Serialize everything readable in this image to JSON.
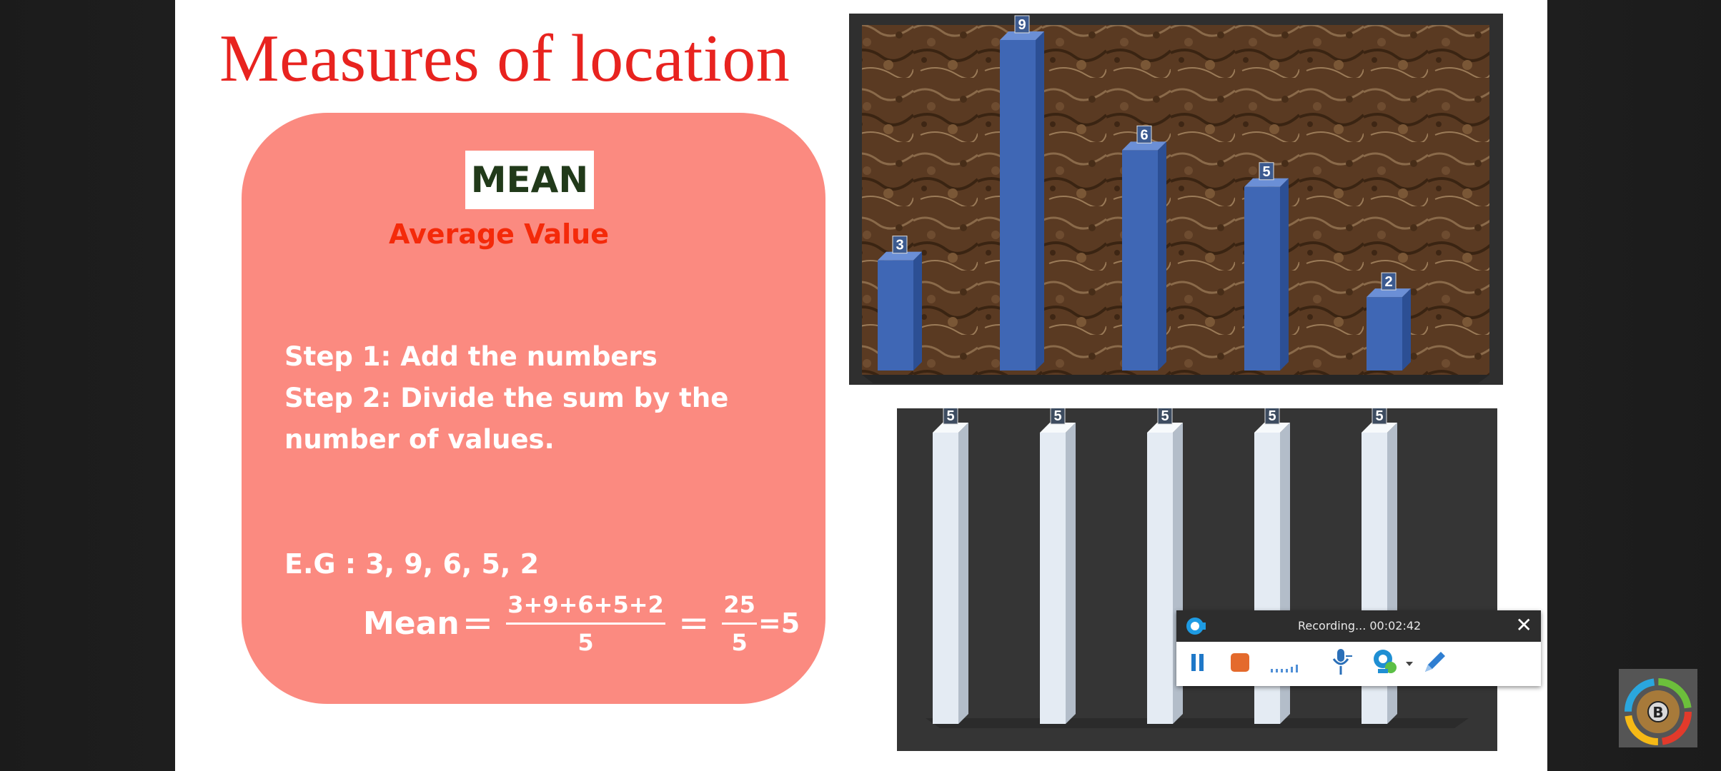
{
  "slide": {
    "title": "Measures of location",
    "card": {
      "heading": "MEAN",
      "subheading": "Average Value",
      "steps": [
        "Step 1: Add the numbers",
        "Step 2: Divide the sum by the",
        "number of values."
      ],
      "example": "E.G :  3,  9,  6,  5, 2",
      "formula": {
        "label": "Mean",
        "numerator": "3+9+6+5+2",
        "denominator": "5",
        "result_numerator": "25",
        "result_denominator": "5",
        "result": "=5"
      }
    },
    "colors": {
      "title": "#e8231f",
      "card_background": "#fb8a80",
      "heading_text": "#213a1a",
      "subheading": "#f42a0a",
      "top_bars": "#3f67b5",
      "bottom_bars": "#e4ebf3"
    }
  },
  "chart_data": [
    {
      "type": "bar",
      "categories": [
        "",
        "",
        "",
        "",
        ""
      ],
      "values": [
        3,
        9,
        6,
        5,
        2
      ],
      "data_labels": [
        "3",
        "9",
        "6",
        "5",
        "2"
      ],
      "ylim": [
        0,
        9
      ]
    },
    {
      "type": "bar",
      "categories": [
        "",
        "",
        "",
        "",
        ""
      ],
      "values": [
        5,
        5,
        5,
        5,
        5
      ],
      "data_labels": [
        "5",
        "5",
        "5",
        "5",
        "5"
      ],
      "ylim": [
        0,
        5
      ]
    }
  ],
  "recording_toolbar": {
    "status": "Recording... 00:02:42",
    "icons": [
      "recorder-logo-icon",
      "close-icon",
      "pause-icon",
      "stop-icon",
      "audio-level-icon",
      "microphone-icon",
      "webcam-icon",
      "dropdown-arrow-icon",
      "pen-icon"
    ]
  },
  "corner_badge": {
    "letter": "B"
  }
}
